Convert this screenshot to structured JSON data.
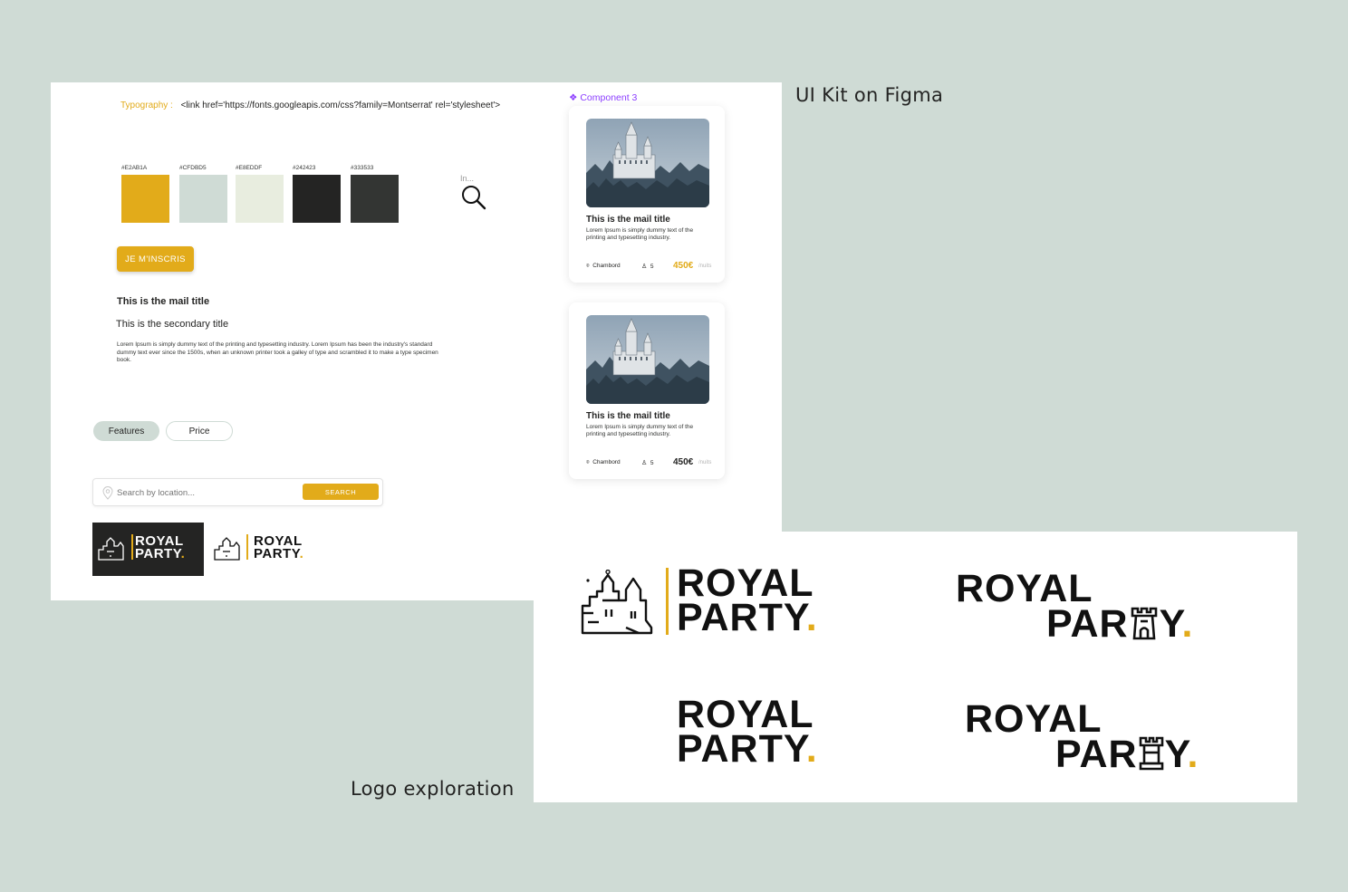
{
  "captions": {
    "ui_kit": "UI Kit on Figma",
    "logo_exploration": "Logo exploration"
  },
  "typography": {
    "label": "Typography :",
    "code": "<link href='https://fonts.googleapis.com/css?family=Montserrat' rel='stylesheet'>"
  },
  "palette": [
    {
      "hex": "#E2AB1A",
      "color": "#E2AB1A"
    },
    {
      "hex": "#CFDBD5",
      "color": "#CFDBD5"
    },
    {
      "hex": "#E8EDDF",
      "color": "#E8EDDF"
    },
    {
      "hex": "#242423",
      "color": "#242423"
    },
    {
      "hex": "#333533",
      "color": "#333533"
    }
  ],
  "search_mini": {
    "placeholder": "In..."
  },
  "cta": {
    "label": "JE M'INSCRIS"
  },
  "text_styles": {
    "main_title": "This is the mail title",
    "secondary_title": "This is the secondary title",
    "body": "Lorem Ipsum is simply dummy text of the printing and typesetting industry. Lorem Ipsum has been the industry's standard dummy text ever since the 1500s, when an unknown printer took a galley of type and scrambled it to make a type specimen book."
  },
  "pills": {
    "features": "Features",
    "price": "Price"
  },
  "searchbar": {
    "placeholder": "Search by location...",
    "button": "SEARCH"
  },
  "brand": {
    "line1": "ROYAL",
    "line2": "PARTY",
    "dot": ".",
    "line2_tower_left": "PAR",
    "line2_tower_right": "Y"
  },
  "component": {
    "label": "Component 3",
    "cards": [
      {
        "title": "This is the mail title",
        "desc": "Lorem Ipsum is simply dummy text of the printing and typesetting industry.",
        "location": "Chambord",
        "guests": "5",
        "price": "450€",
        "unit": "/nuits",
        "price_color": "#E2AB1A"
      },
      {
        "title": "This is the mail title",
        "desc": "Lorem Ipsum is simply dummy text of the printing and typesetting industry.",
        "location": "Chambord",
        "guests": "5",
        "price": "450€",
        "unit": "/nuits",
        "price_color": "#242423"
      }
    ]
  }
}
